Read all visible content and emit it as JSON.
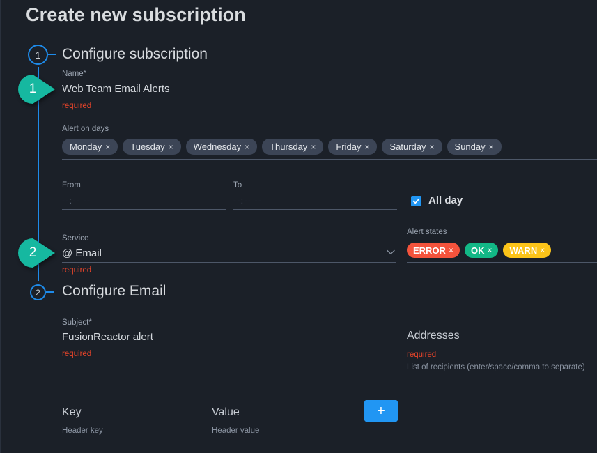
{
  "page": {
    "title": "Create new subscription"
  },
  "colors": {
    "background": "#1b2028",
    "accent_blue": "#2196f3",
    "rail_blue": "#1e8bea",
    "callout_teal": "#16b8a0",
    "required_red": "#e8442a",
    "chip_day_bg": "#3c4556",
    "state_error": "#f4533c",
    "state_ok": "#12b886",
    "state_warn": "#fcc419"
  },
  "steps": [
    {
      "number": "1",
      "heading": "Configure subscription"
    },
    {
      "number": "2",
      "heading": "Configure Email"
    }
  ],
  "callouts": [
    {
      "number": "1"
    },
    {
      "number": "2"
    }
  ],
  "fields": {
    "name": {
      "label": "Name*",
      "value": "Web Team Email Alerts",
      "hint": "required"
    },
    "alert_on_days": {
      "label": "Alert on days",
      "chips": [
        {
          "label": "Monday",
          "remove": "×"
        },
        {
          "label": "Tuesday",
          "remove": "×"
        },
        {
          "label": "Wednesday",
          "remove": "×"
        },
        {
          "label": "Thursday",
          "remove": "×"
        },
        {
          "label": "Friday",
          "remove": "×"
        },
        {
          "label": "Saturday",
          "remove": "×"
        },
        {
          "label": "Sunday",
          "remove": "×"
        }
      ]
    },
    "from": {
      "label": "From",
      "value": "",
      "placeholder": "--:-- --"
    },
    "to": {
      "label": "To",
      "value": "",
      "placeholder": "--:-- --"
    },
    "all_day": {
      "label": "All day",
      "checked": true
    },
    "service": {
      "label": "Service",
      "value": "@  Email",
      "hint": "required"
    },
    "alert_states": {
      "label": "Alert states",
      "chips": [
        {
          "label": "ERROR",
          "remove": "×",
          "color": "#f4533c"
        },
        {
          "label": "OK",
          "remove": "×",
          "color": "#12b886"
        },
        {
          "label": "WARN",
          "remove": "×",
          "color": "#fcc419"
        }
      ]
    },
    "subject": {
      "label": "Subject*",
      "value": "FusionReactor alert",
      "hint": "required"
    },
    "addresses": {
      "label": "Addresses",
      "value": "",
      "hint_required": "required",
      "hint_help": "List of recipients (enter/space/comma to separate)"
    },
    "header_key": {
      "label": "Key",
      "value": "",
      "hint": "Header key"
    },
    "header_value": {
      "label": "Value",
      "value": "",
      "hint": "Header value"
    },
    "add_header_button": {
      "label": "+"
    }
  }
}
